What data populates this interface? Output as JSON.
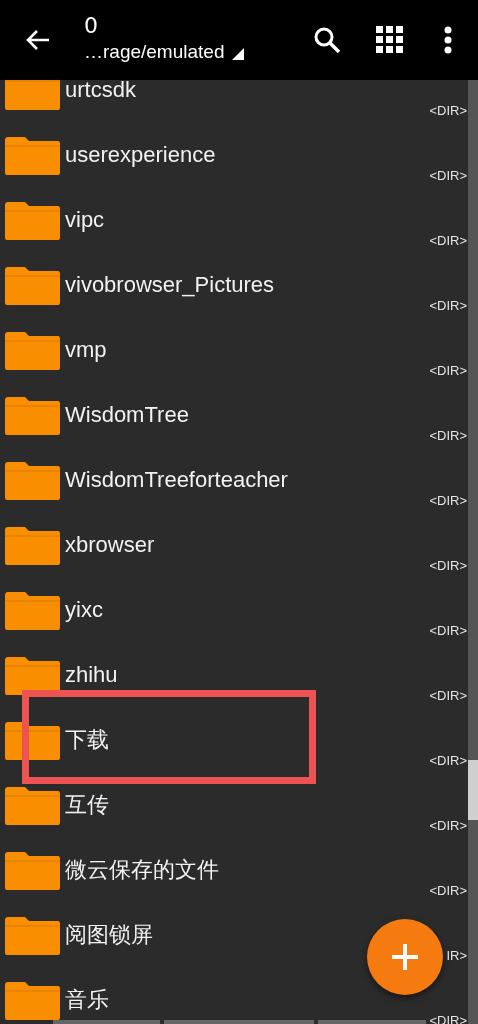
{
  "toolbar": {
    "title": "0",
    "path": "…rage/emulated"
  },
  "files": [
    {
      "name": "urtcsdk",
      "info": "<DIR>"
    },
    {
      "name": "userexperience",
      "info": "<DIR>"
    },
    {
      "name": "vipc",
      "info": "<DIR>"
    },
    {
      "name": "vivobrowser_Pictures",
      "info": "<DIR>"
    },
    {
      "name": "vmp",
      "info": "<DIR>"
    },
    {
      "name": "WisdomTree",
      "info": "<DIR>"
    },
    {
      "name": "WisdomTreeforteacher",
      "info": "<DIR>"
    },
    {
      "name": "xbrowser",
      "info": "<DIR>"
    },
    {
      "name": "yixc",
      "info": "<DIR>"
    },
    {
      "name": "zhihu",
      "info": "<DIR>"
    },
    {
      "name": "下载",
      "info": "<DIR>",
      "highlighted": true
    },
    {
      "name": "互传",
      "info": "<DIR>"
    },
    {
      "name": "微云保存的文件",
      "info": "<DIR>"
    },
    {
      "name": "阅图锁屏",
      "info": "IR>"
    },
    {
      "name": "音乐",
      "info": "<DIR>"
    }
  ]
}
